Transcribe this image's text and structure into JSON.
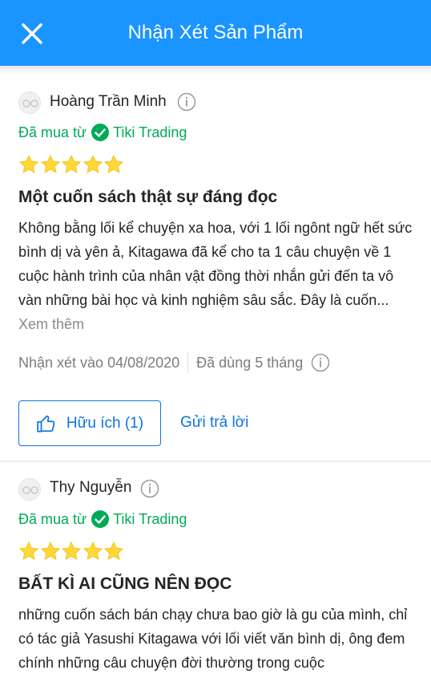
{
  "header": {
    "title": "Nhận Xét Sản Phẩm"
  },
  "reviews": [
    {
      "author": "Hoàng Trần Minh",
      "purchased_prefix": "Đã mua từ",
      "seller": "Tiki Trading",
      "rating": 5,
      "title": "Một cuốn sách thật sự đáng đọc",
      "content": "Không bằng lối kể chuyện xa hoa, với 1 lối ngônt ngữ hết sức bình dị và yên ả, Kitagawa đã kể cho ta 1 câu chuyện về 1 cuộc hành trình của nhân vật đồng thời nhắn gửi đến ta vô vàn những bài học và kinh nghiệm sâu sắc. Đây là cuốn...",
      "see_more": "Xem thêm",
      "review_date": "Nhận xét vào 04/08/2020",
      "usage": "Đã dùng 5 tháng",
      "helpful_label": "Hữu ích (1)",
      "reply_label": "Gửi trả lời"
    },
    {
      "author": "Thy Nguyễn",
      "purchased_prefix": "Đã mua từ",
      "seller": "Tiki Trading",
      "rating": 5,
      "title": "BẤT KÌ AI CŨNG NÊN ĐỌC",
      "content": "những cuốn sách bán chạy chưa bao giờ là gu của mình, chỉ có tác giả Yasushi Kitagawa với lối viết văn bình dị, ông đem chính những câu chuyện đời thường trong cuộc"
    }
  ],
  "colors": {
    "header_bg": "#1a94ff",
    "accent_blue": "#0b74e5",
    "verified_green": "#00ab56",
    "star_yellow": "#fdd836"
  },
  "icons": {
    "close": "close-icon",
    "info": "info-icon",
    "verified": "check-circle-icon",
    "star": "star-icon",
    "like": "thumbs-up-icon"
  }
}
